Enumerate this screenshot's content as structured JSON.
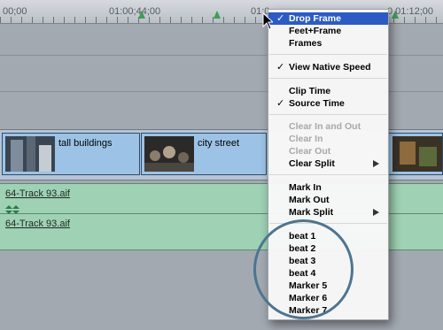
{
  "ruler": {
    "timecodes": [
      "00;00",
      "01:00;44;00",
      "01:0",
      "0 01:12;00"
    ]
  },
  "clips": [
    {
      "name": ""
    },
    {
      "name": "tall buildings"
    },
    {
      "name": "city street"
    },
    {
      "name": ""
    }
  ],
  "audio_tracks": [
    {
      "name": "64-Track 93.aif"
    },
    {
      "name": "64-Track 93.aif"
    }
  ],
  "menu": {
    "items": [
      {
        "label": "Drop Frame",
        "checked": true,
        "selected": true,
        "disabled": false
      },
      {
        "label": "Feet+Frame",
        "checked": false,
        "disabled": false
      },
      {
        "label": "Frames",
        "checked": false,
        "disabled": false
      },
      {
        "label": "View Native Speed",
        "checked": true,
        "disabled": false
      },
      {
        "label": "Clip Time",
        "checked": false,
        "disabled": false
      },
      {
        "label": "Source Time",
        "checked": true,
        "disabled": false
      },
      {
        "label": "Clear In and Out",
        "checked": false,
        "disabled": true
      },
      {
        "label": "Clear In",
        "checked": false,
        "disabled": true
      },
      {
        "label": "Clear Out",
        "checked": false,
        "disabled": true
      },
      {
        "label": "Clear Split",
        "checked": false,
        "disabled": false,
        "submenu": true
      },
      {
        "label": "Mark In",
        "checked": false,
        "disabled": false
      },
      {
        "label": "Mark Out",
        "checked": false,
        "disabled": false
      },
      {
        "label": "Mark Split",
        "checked": false,
        "disabled": false,
        "submenu": true
      },
      {
        "label": "beat 1",
        "checked": false,
        "disabled": false
      },
      {
        "label": "beat 2",
        "checked": false,
        "disabled": false
      },
      {
        "label": "beat 3",
        "checked": false,
        "disabled": false
      },
      {
        "label": "beat 4",
        "checked": false,
        "disabled": false
      },
      {
        "label": "Marker 5",
        "checked": false,
        "disabled": false
      },
      {
        "label": "Marker 6",
        "checked": false,
        "disabled": false
      },
      {
        "label": "Marker 7",
        "checked": false,
        "disabled": false
      }
    ],
    "check_glyph": "✓"
  },
  "colors": {
    "selection": "#2d5bc3",
    "video_clip": "#9cc3e6",
    "audio_clip": "#9fd1b4",
    "highlight_circle": "#4d7590"
  }
}
